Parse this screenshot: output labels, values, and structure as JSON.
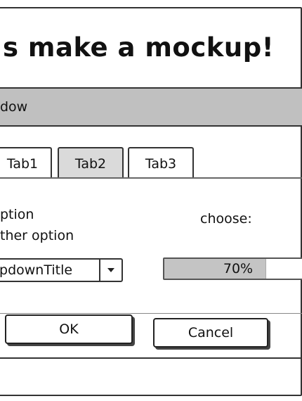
{
  "mockup": {
    "title": "t's make a mockup!"
  },
  "window": {
    "title": "dow"
  },
  "tabs": [
    {
      "label": "Tab1",
      "active": false
    },
    {
      "label": "Tab2",
      "active": true
    },
    {
      "label": "Tab3",
      "active": false
    }
  ],
  "options": {
    "option1": "ption",
    "option2": "ther option"
  },
  "choose_label": "choose:",
  "dropdown": {
    "selected": "ropdownTitle",
    "icon": "chevron-down-icon"
  },
  "progress": {
    "label": "70%",
    "value": 0.7
  },
  "buttons": {
    "ok": "OK",
    "cancel": "Cancel"
  },
  "colors": {
    "titlebar": "#c0c0c0",
    "active_tab": "#dadada",
    "progress_fill": "#c4c4c4"
  }
}
